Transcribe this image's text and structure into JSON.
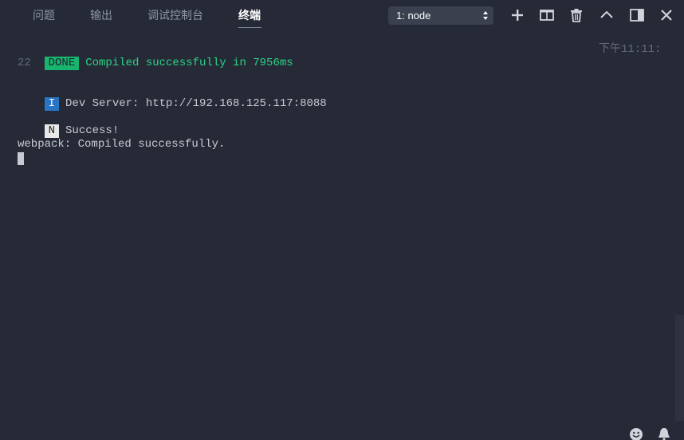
{
  "tabs": [
    {
      "label": "问题"
    },
    {
      "label": "输出"
    },
    {
      "label": "调试控制台"
    },
    {
      "label": "终端"
    }
  ],
  "active_tab": "终端",
  "terminal_select": {
    "value": "1: node"
  },
  "toolbar": {
    "icons": [
      "plus-icon",
      "split-icon",
      "trash-icon",
      "chevron-up-icon",
      "panel-toggle-icon",
      "close-icon"
    ]
  },
  "terminal": {
    "done_badge": "DONE",
    "done_message": "Compiled successfully in 7956ms",
    "timestamp": "下午11:11:",
    "timestamp_wrap": "22",
    "info_badge": "I",
    "info_message": "Dev Server: http://192.168.125.117:8088",
    "notice_badge": "N",
    "notice_message": "Success!",
    "webpack_message": "webpack: Compiled successfully."
  },
  "status_icons": [
    "smiley-icon",
    "bell-icon"
  ],
  "colors": {
    "background": "#262a37",
    "done_green": "#19b46e",
    "info_blue": "#2775c4",
    "text": "#c6cad3"
  }
}
